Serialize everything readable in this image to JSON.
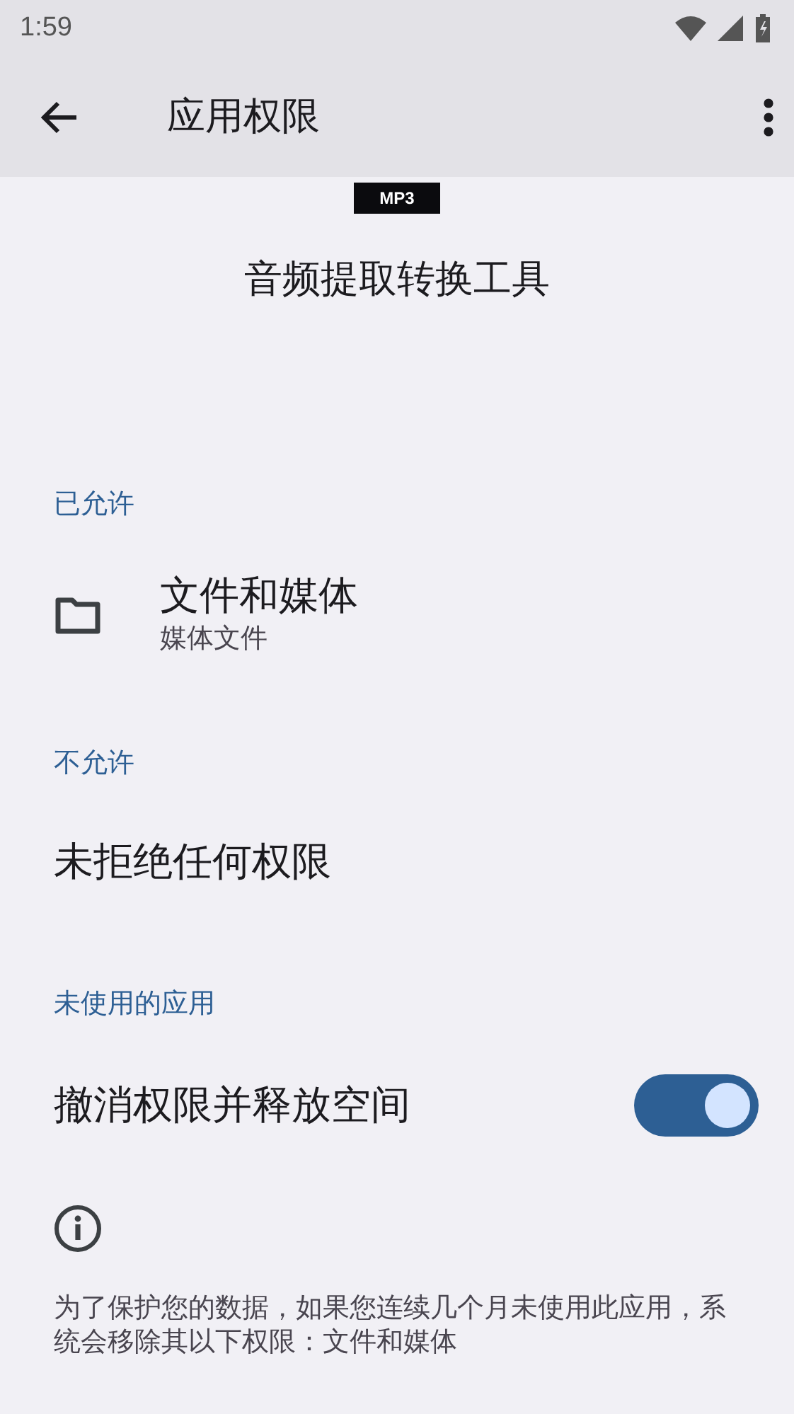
{
  "status_bar": {
    "time": "1:59"
  },
  "app_bar": {
    "title": "应用权限"
  },
  "app": {
    "badge": "MP3",
    "name": "音频提取转换工具"
  },
  "sections": [
    {
      "header": "已允许",
      "items": [
        {
          "kind": "permission",
          "title": "文件和媒体",
          "subtitle": "媒体文件"
        }
      ]
    },
    {
      "header": "不允许",
      "items": [
        {
          "kind": "empty",
          "title": "未拒绝任何权限"
        }
      ]
    },
    {
      "header": "未使用的应用",
      "items": [
        {
          "kind": "toggle",
          "title": "撤消权限并释放空间",
          "on": true
        }
      ]
    }
  ],
  "footer": {
    "text": "为了保护您的数据，如果您连续几个月未使用此应用，系统会移除其以下权限：文件和媒体"
  }
}
